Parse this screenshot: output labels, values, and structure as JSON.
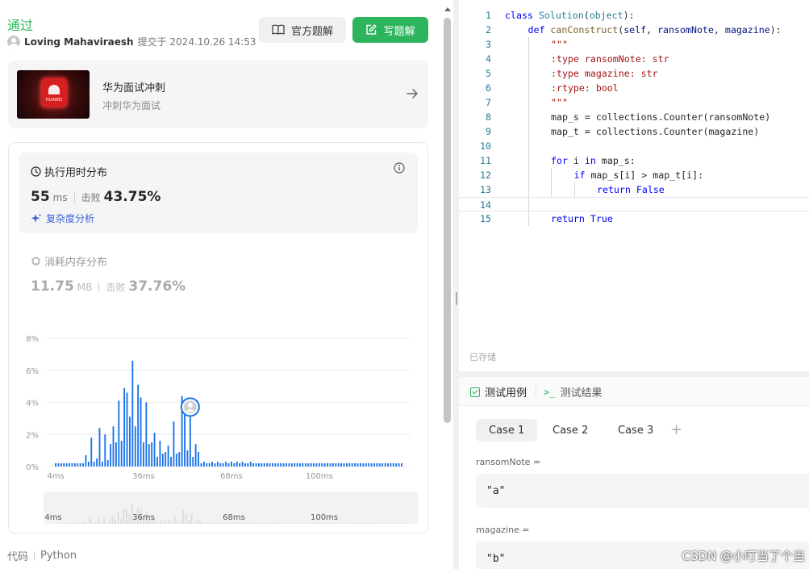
{
  "submission": {
    "status": "通过",
    "author": "Loving Mahaviraesh",
    "meta": "提交于 2024.10.26 14:53"
  },
  "buttons": {
    "official": "官方题解",
    "write": "写题解"
  },
  "promo": {
    "title": "华为面试冲刺",
    "subtitle": "冲刺华为面试",
    "logo_text": "HUAWEI"
  },
  "runtime": {
    "title": "执行用时分布",
    "value": "55",
    "unit": "ms",
    "beats_label": "击败",
    "beats": "43.75%",
    "complexity": "复杂度分析"
  },
  "memory": {
    "title": "消耗内存分布",
    "value": "11.75",
    "unit": "MB",
    "beats_label": "击败",
    "beats": "37.76%"
  },
  "chart_data": {
    "type": "bar",
    "title": "",
    "xlabel": "",
    "ylabel": "",
    "ylim": [
      0,
      8
    ],
    "y_ticks": [
      "0%",
      "2%",
      "4%",
      "6%",
      "8%"
    ],
    "x_ticks": [
      "4ms",
      "36ms",
      "68ms",
      "100ms"
    ],
    "x_tick_values": [
      4,
      36,
      68,
      100
    ],
    "grid": true,
    "highlight_x": 53,
    "x": [
      4,
      5,
      6,
      7,
      8,
      9,
      10,
      11,
      12,
      13,
      14,
      15,
      16,
      17,
      18,
      19,
      20,
      21,
      22,
      23,
      24,
      25,
      26,
      27,
      28,
      29,
      30,
      31,
      32,
      33,
      34,
      35,
      36,
      37,
      38,
      39,
      40,
      41,
      42,
      43,
      44,
      45,
      46,
      47,
      48,
      49,
      50,
      51,
      52,
      53,
      54,
      55,
      56,
      57,
      58,
      59,
      60,
      61,
      62,
      63,
      64,
      65,
      66,
      67,
      68,
      69,
      70,
      71,
      72,
      73,
      74,
      75,
      76,
      77,
      78,
      79,
      80,
      81,
      82,
      83,
      84,
      85,
      86,
      87,
      88,
      89,
      90,
      91,
      92,
      93,
      94,
      95,
      96,
      97,
      98,
      99,
      100,
      101,
      102,
      103,
      104,
      105,
      106,
      107,
      108,
      109,
      110,
      111,
      112,
      113,
      114,
      115,
      116,
      117,
      118,
      119,
      120,
      121,
      122,
      123,
      124,
      125,
      126,
      127,
      128,
      129,
      130
    ],
    "values": [
      0.2,
      0.2,
      0.2,
      0.2,
      0.2,
      0.2,
      0.2,
      0.2,
      0.2,
      0.2,
      0.2,
      0.7,
      0.3,
      1.8,
      0.3,
      0.5,
      2.4,
      0.3,
      2.0,
      0.4,
      1.4,
      2.5,
      1.5,
      4.1,
      1.6,
      4.9,
      4.6,
      3.1,
      6.6,
      2.5,
      5.1,
      4.3,
      1.5,
      4.0,
      1.4,
      1.5,
      2.1,
      0.6,
      1.6,
      0.8,
      0.9,
      1.3,
      0.6,
      2.8,
      0.8,
      0.9,
      4.4,
      3.3,
      1.0,
      3.1,
      0.6,
      1.4,
      0.9,
      0.2,
      0.3,
      0.2,
      0.2,
      0.3,
      0.2,
      0.3,
      0.2,
      0.2,
      0.3,
      0.2,
      0.3,
      0.2,
      0.3,
      0.2,
      0.3,
      0.2,
      0.2,
      0.3,
      0.2,
      0.2,
      0.2,
      0.2,
      0.2,
      0.2,
      0.2,
      0.2,
      0.2,
      0.2,
      0.2,
      0.2,
      0.2,
      0.2,
      0.2,
      0.2,
      0.2,
      0.2,
      0.2,
      0.2,
      0.2,
      0.2,
      0.2,
      0.2,
      0.2,
      0.2,
      0.2,
      0.2,
      0.2,
      0.2,
      0.2,
      0.2,
      0.2,
      0.2,
      0.2,
      0.2,
      0.2,
      0.2,
      0.2,
      0.2,
      0.2,
      0.2,
      0.2,
      0.2,
      0.2,
      0.2,
      0.2,
      0.2,
      0.2,
      0.2,
      0.2,
      0.2,
      0.2,
      0.2,
      0.2
    ]
  },
  "footer": {
    "code_label": "代码",
    "language": "Python"
  },
  "editor": {
    "saved": "已存储",
    "lines": [
      {
        "n": "1",
        "indent": 0,
        "tokens": [
          [
            "k",
            "class"
          ],
          [
            "",
            ""
          ],
          [
            "c",
            " Solution"
          ],
          [
            "",
            "("
          ],
          [
            "c",
            "object"
          ],
          [
            "",
            "):"
          ]
        ]
      },
      {
        "n": "2",
        "indent": 1,
        "tokens": [
          [
            "k",
            "def"
          ],
          [
            "f",
            " canConstruct"
          ],
          [
            "",
            "("
          ],
          [
            "p",
            "self"
          ],
          [
            "",
            ", "
          ],
          [
            "p",
            "ransomNote"
          ],
          [
            "",
            ", "
          ],
          [
            "p",
            "magazine"
          ],
          [
            "",
            "):"
          ]
        ]
      },
      {
        "n": "3",
        "indent": 2,
        "tokens": [
          [
            "s",
            "\"\"\""
          ]
        ]
      },
      {
        "n": "4",
        "indent": 2,
        "tokens": [
          [
            "s",
            ":type ransomNote: str"
          ]
        ]
      },
      {
        "n": "5",
        "indent": 2,
        "tokens": [
          [
            "s",
            ":type magazine: str"
          ]
        ]
      },
      {
        "n": "6",
        "indent": 2,
        "tokens": [
          [
            "s",
            ":rtype: bool"
          ]
        ]
      },
      {
        "n": "7",
        "indent": 2,
        "tokens": [
          [
            "s",
            "\"\"\""
          ]
        ]
      },
      {
        "n": "8",
        "indent": 2,
        "tokens": [
          [
            "",
            "map_s = collections.Counter(ransomNote)"
          ]
        ]
      },
      {
        "n": "9",
        "indent": 2,
        "tokens": [
          [
            "",
            "map_t = collections.Counter(magazine)"
          ]
        ]
      },
      {
        "n": "10",
        "indent": 2,
        "tokens": []
      },
      {
        "n": "11",
        "indent": 2,
        "tokens": [
          [
            "k",
            "for"
          ],
          [
            "",
            " i "
          ],
          [
            "k",
            "in"
          ],
          [
            "",
            " map_s:"
          ]
        ]
      },
      {
        "n": "12",
        "indent": 3,
        "tokens": [
          [
            "k",
            "if"
          ],
          [
            "",
            " map_s[i] > map_t[i]:"
          ]
        ]
      },
      {
        "n": "13",
        "indent": 4,
        "tokens": [
          [
            "k",
            "return"
          ],
          [
            "",
            " "
          ],
          [
            "k",
            "False"
          ]
        ]
      },
      {
        "n": "14",
        "indent": 2,
        "tokens": [],
        "active": true
      },
      {
        "n": "15",
        "indent": 2,
        "tokens": [
          [
            "k",
            "return"
          ],
          [
            "",
            " "
          ],
          [
            "k",
            "True"
          ]
        ]
      }
    ]
  },
  "testcase": {
    "tab_testcase": "测试用例",
    "tab_result": "测试结果",
    "term_symbol": ">_",
    "cases": [
      "Case 1",
      "Case 2",
      "Case 3"
    ],
    "add": "+",
    "fields": [
      {
        "label": "ransomNote =",
        "value": "\"a\""
      },
      {
        "label": "magazine =",
        "value": "\"b\""
      }
    ]
  },
  "watermark": "CSDN @小叮当了个当",
  "colors": {
    "accent_green": "#2db55d",
    "bar_blue": "#1a73e8",
    "link_blue": "#3c63d6"
  }
}
